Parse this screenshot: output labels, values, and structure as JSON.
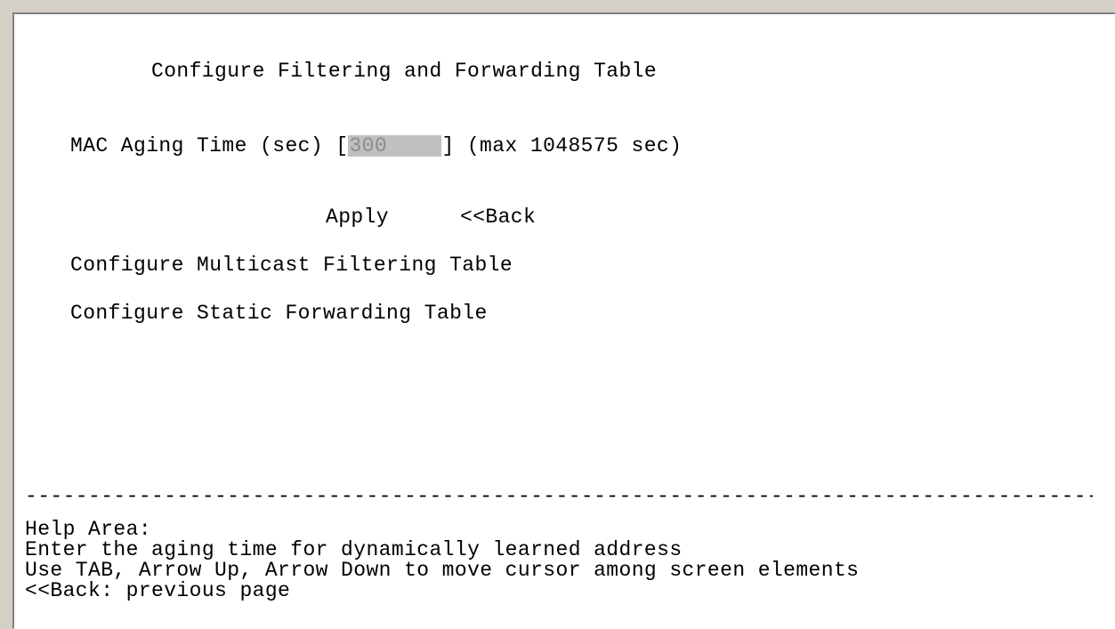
{
  "screen": {
    "title": "Configure Filtering and Forwarding Table",
    "aging": {
      "label_prefix": "MAC Aging Time (sec) [",
      "value": "300",
      "label_suffix": "] (max 1048575 sec)"
    },
    "buttons": {
      "apply": "Apply",
      "back": "<<Back"
    },
    "menu": {
      "multicast": "Configure Multicast Filtering Table",
      "static": "Configure Static Forwarding Table"
    },
    "divider": "----------------------------------------------------------------------------------------------------------------------------------------------------------------",
    "help": [
      "Help Area:",
      "Enter the aging time for dynamically learned address",
      "Use TAB, Arrow Up, Arrow Down to move cursor among screen elements",
      "<<Back: previous page"
    ]
  },
  "colors": {
    "background": "#ffffff",
    "text": "#000000",
    "field_background": "#c0c0c0",
    "field_text": "#8c8c8c",
    "window_frame": "#d4d0c8"
  }
}
